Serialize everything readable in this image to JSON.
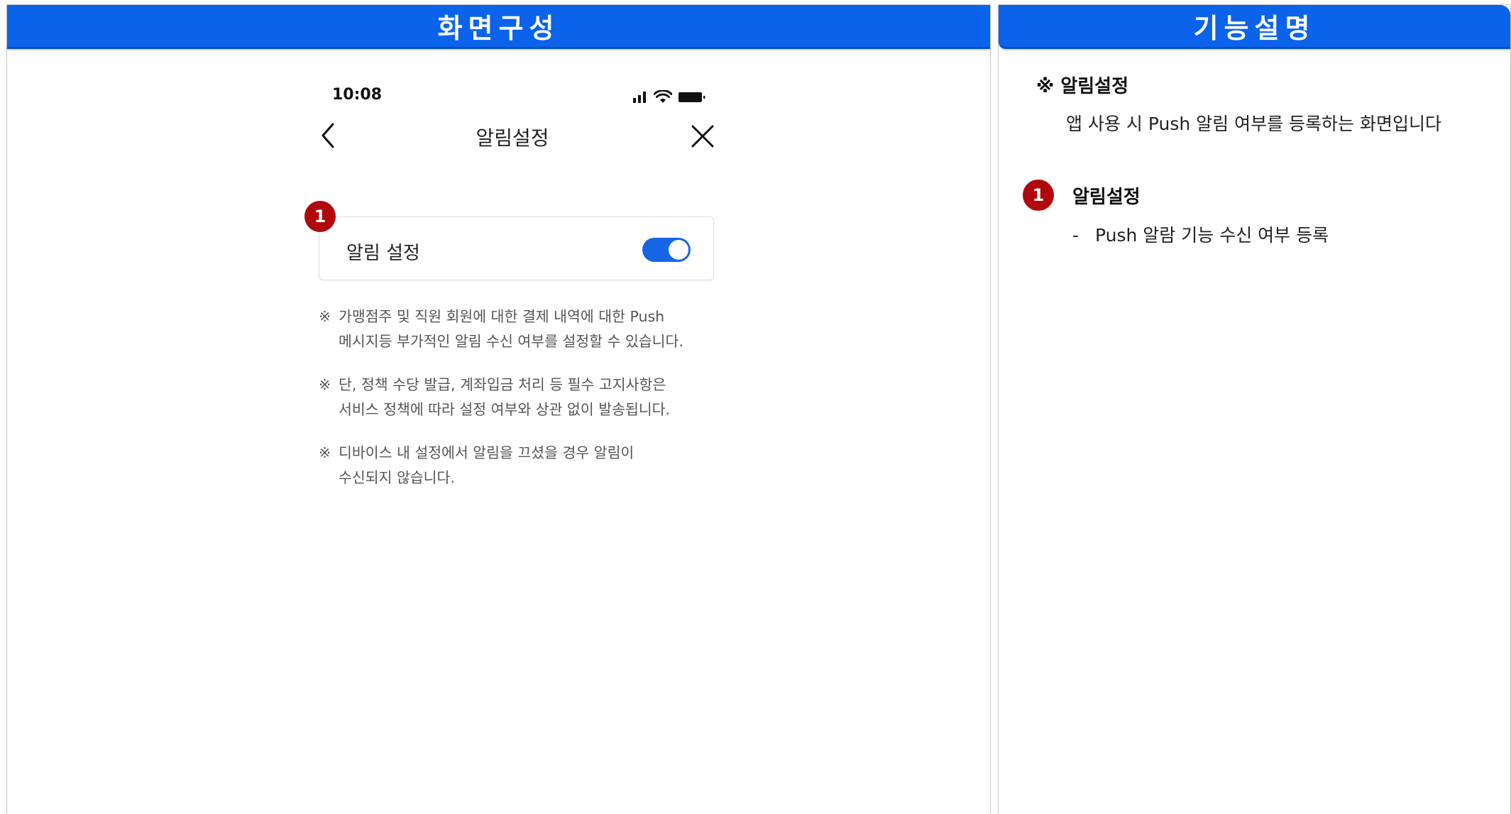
{
  "left_panel": {
    "header": "화면구성"
  },
  "right_panel": {
    "header": "기능설명"
  },
  "phone": {
    "status_time": "10:08",
    "nav_title": "알림설정",
    "badge_number": "1",
    "setting_label": "알림 설정",
    "toggle_on": true,
    "notes": [
      {
        "mark": "※",
        "text": "가맹점주 및 직원 회원에 대한 결제 내역에 대한 Push\n메시지등 부가적인 알림 수신 여부를 설정할 수 있습니다."
      },
      {
        "mark": "※",
        "text": "단, 정책 수당 발급, 계좌입금 처리 등 필수 고지사항은\n서비스 정책에 따라 설정 여부와 상관 없이 발송됩니다."
      },
      {
        "mark": "※",
        "text": "디바이스 내 설정에서 알림을 끄셨을 경우 알림이\n수신되지 않습니다."
      }
    ]
  },
  "description": {
    "heading": "※ 알림설정",
    "body": "앱 사용 시 Push 알림 여부를 등록하는 화면입니다",
    "item": {
      "number": "1",
      "title": "알림설정",
      "dash": "-",
      "line": "Push 알람 기능 수신 여부 등록"
    }
  },
  "colors": {
    "header_blue": "#0a63ea",
    "toggle_blue": "#1565e6",
    "badge_red": "#b0080d"
  }
}
